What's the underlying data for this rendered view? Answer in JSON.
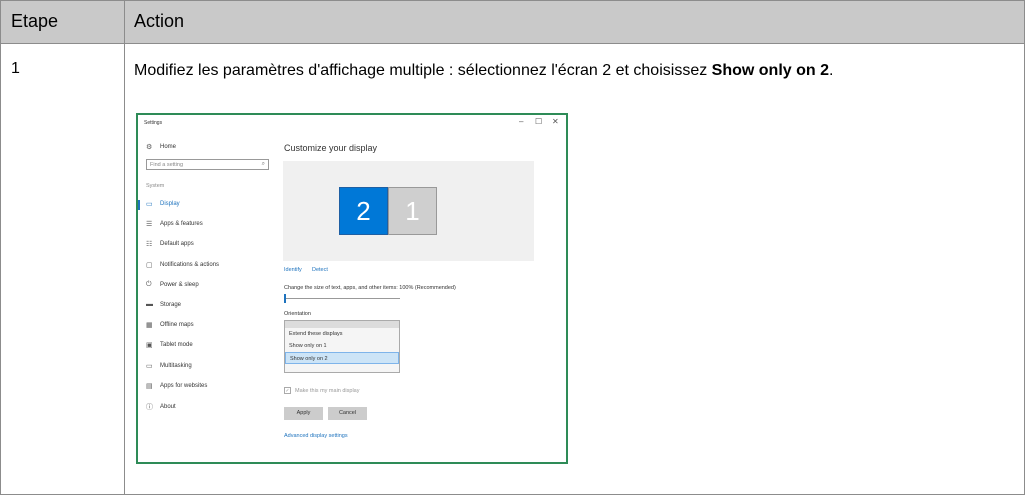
{
  "table": {
    "col_etape": "Etape",
    "col_action": "Action",
    "step_number": "1",
    "instruction_prefix": "Modifiez les paramètres d'affichage multiple : sélectionnez l'écran 2 et choisissez ",
    "instruction_bold": "Show only on 2",
    "instruction_suffix": "."
  },
  "settings_window": {
    "title": "Settings",
    "window_controls": {
      "minimize": "–",
      "maximize": "☐",
      "close": "✕"
    },
    "sidebar": {
      "home": "Home",
      "search_placeholder": "Find a setting",
      "section": "System",
      "items": [
        {
          "label": "Display",
          "icon": "monitor-icon",
          "glyph": "▭",
          "active": true
        },
        {
          "label": "Apps & features",
          "icon": "list-icon",
          "glyph": "☰",
          "active": false
        },
        {
          "label": "Default apps",
          "icon": "default-apps-icon",
          "glyph": "☷",
          "active": false
        },
        {
          "label": "Notifications & actions",
          "icon": "notification-icon",
          "glyph": "▢",
          "active": false
        },
        {
          "label": "Power & sleep",
          "icon": "power-icon",
          "glyph": "⏻",
          "active": false
        },
        {
          "label": "Storage",
          "icon": "storage-icon",
          "glyph": "▬",
          "active": false
        },
        {
          "label": "Offline maps",
          "icon": "map-icon",
          "glyph": "▦",
          "active": false
        },
        {
          "label": "Tablet mode",
          "icon": "tablet-icon",
          "glyph": "▣",
          "active": false
        },
        {
          "label": "Multitasking",
          "icon": "multitask-icon",
          "glyph": "▭",
          "active": false
        },
        {
          "label": "Apps for websites",
          "icon": "web-apps-icon",
          "glyph": "▤",
          "active": false
        },
        {
          "label": "About",
          "icon": "info-icon",
          "glyph": "ⓘ",
          "active": false
        }
      ]
    },
    "main": {
      "title": "Customize your display",
      "monitor_2": "2",
      "monitor_1": "1",
      "identify": "Identify",
      "detect": "Detect",
      "scale_label": "Change the size of text, apps, and other items: 100% (Recommended)",
      "orientation_label": "Orientation",
      "dropdown_options": [
        "Extend these displays",
        "Show only on 1",
        "Show only on 2"
      ],
      "selected_option": "Show only on 2",
      "main_display_checkbox": "Make this my main display",
      "apply": "Apply",
      "cancel": "Cancel",
      "advanced": "Advanced display settings"
    }
  },
  "colors": {
    "header_bg": "#c9c9c9",
    "accent_blue": "#0078d7",
    "screenshot_border": "#2e8b57"
  }
}
